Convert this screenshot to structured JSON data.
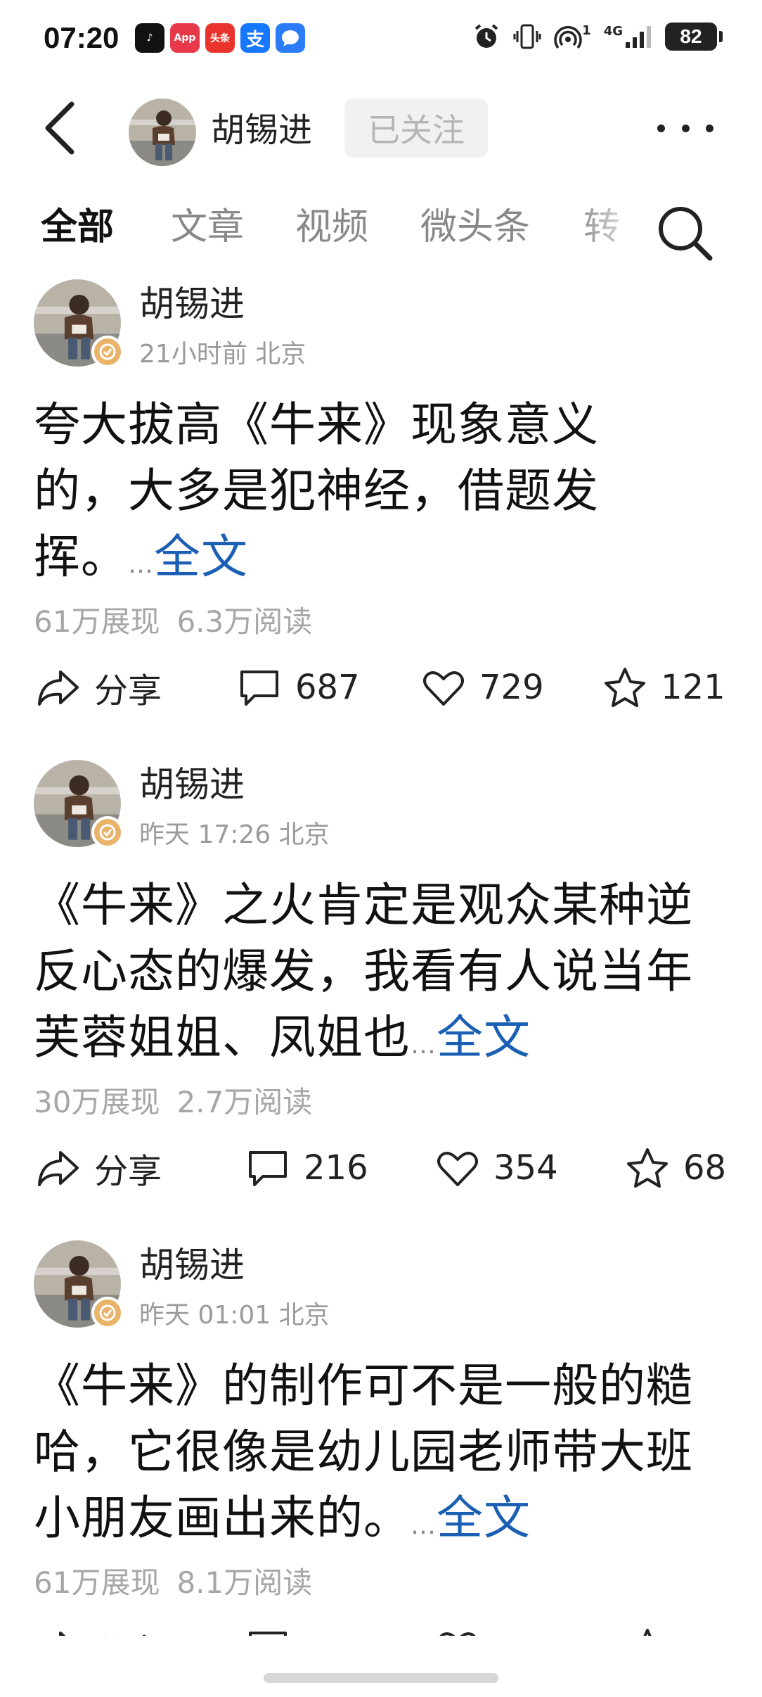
{
  "status_bar": {
    "time": "07:20",
    "apps": [
      {
        "name": "tiktok-icon",
        "label": "♪"
      },
      {
        "name": "app-gallery-icon",
        "label": "App"
      },
      {
        "name": "toutiao-icon",
        "label": "头条"
      },
      {
        "name": "alipay-icon",
        "label": "支"
      },
      {
        "name": "message-icon",
        "label": ""
      }
    ],
    "network": "4G",
    "hotspot_badge": "1",
    "battery": "82"
  },
  "header": {
    "name": "胡锡进",
    "follow_label": "已关注"
  },
  "tabs": [
    {
      "label": "全部",
      "active": true
    },
    {
      "label": "文章",
      "active": false
    },
    {
      "label": "视频",
      "active": false
    },
    {
      "label": "微头条",
      "active": false
    },
    {
      "label": "转",
      "active": false
    }
  ],
  "posts": [
    {
      "author": "胡锡进",
      "time": "21小时前",
      "location": "北京",
      "text": "夸大拔高《牛来》现象意义的，大多是犯神经，借题发挥。",
      "ellipsis": "…",
      "full_text_link": "全文",
      "impressions": "61万展现",
      "reads": "6.3万阅读",
      "share_label": "分享",
      "comments": "687",
      "likes": "729",
      "favorites": "121"
    },
    {
      "author": "胡锡进",
      "time": "昨天 17:26",
      "location": "北京",
      "text": "《牛来》之火肯定是观众某种逆反心态的爆发，我看有人说当年芙蓉姐姐、凤姐也",
      "ellipsis": "…",
      "full_text_link": "全文",
      "impressions": "30万展现",
      "reads": "2.7万阅读",
      "share_label": "分享",
      "comments": "216",
      "likes": "354",
      "favorites": "68"
    },
    {
      "author": "胡锡进",
      "time": "昨天 01:01",
      "location": "北京",
      "text": "《牛来》的制作可不是一般的糙哈，它很像是幼儿园老师带大班小朋友画出来的。",
      "ellipsis": "…",
      "full_text_link": "全文",
      "impressions": "61万展现",
      "reads": "8.1万阅读",
      "share_label": "分享"
    }
  ],
  "colors": {
    "link": "#1a5fb4",
    "verified_badge": "#e9b46a",
    "muted_text": "#9a9a9a",
    "follow_bg": "#f1f1f1"
  }
}
